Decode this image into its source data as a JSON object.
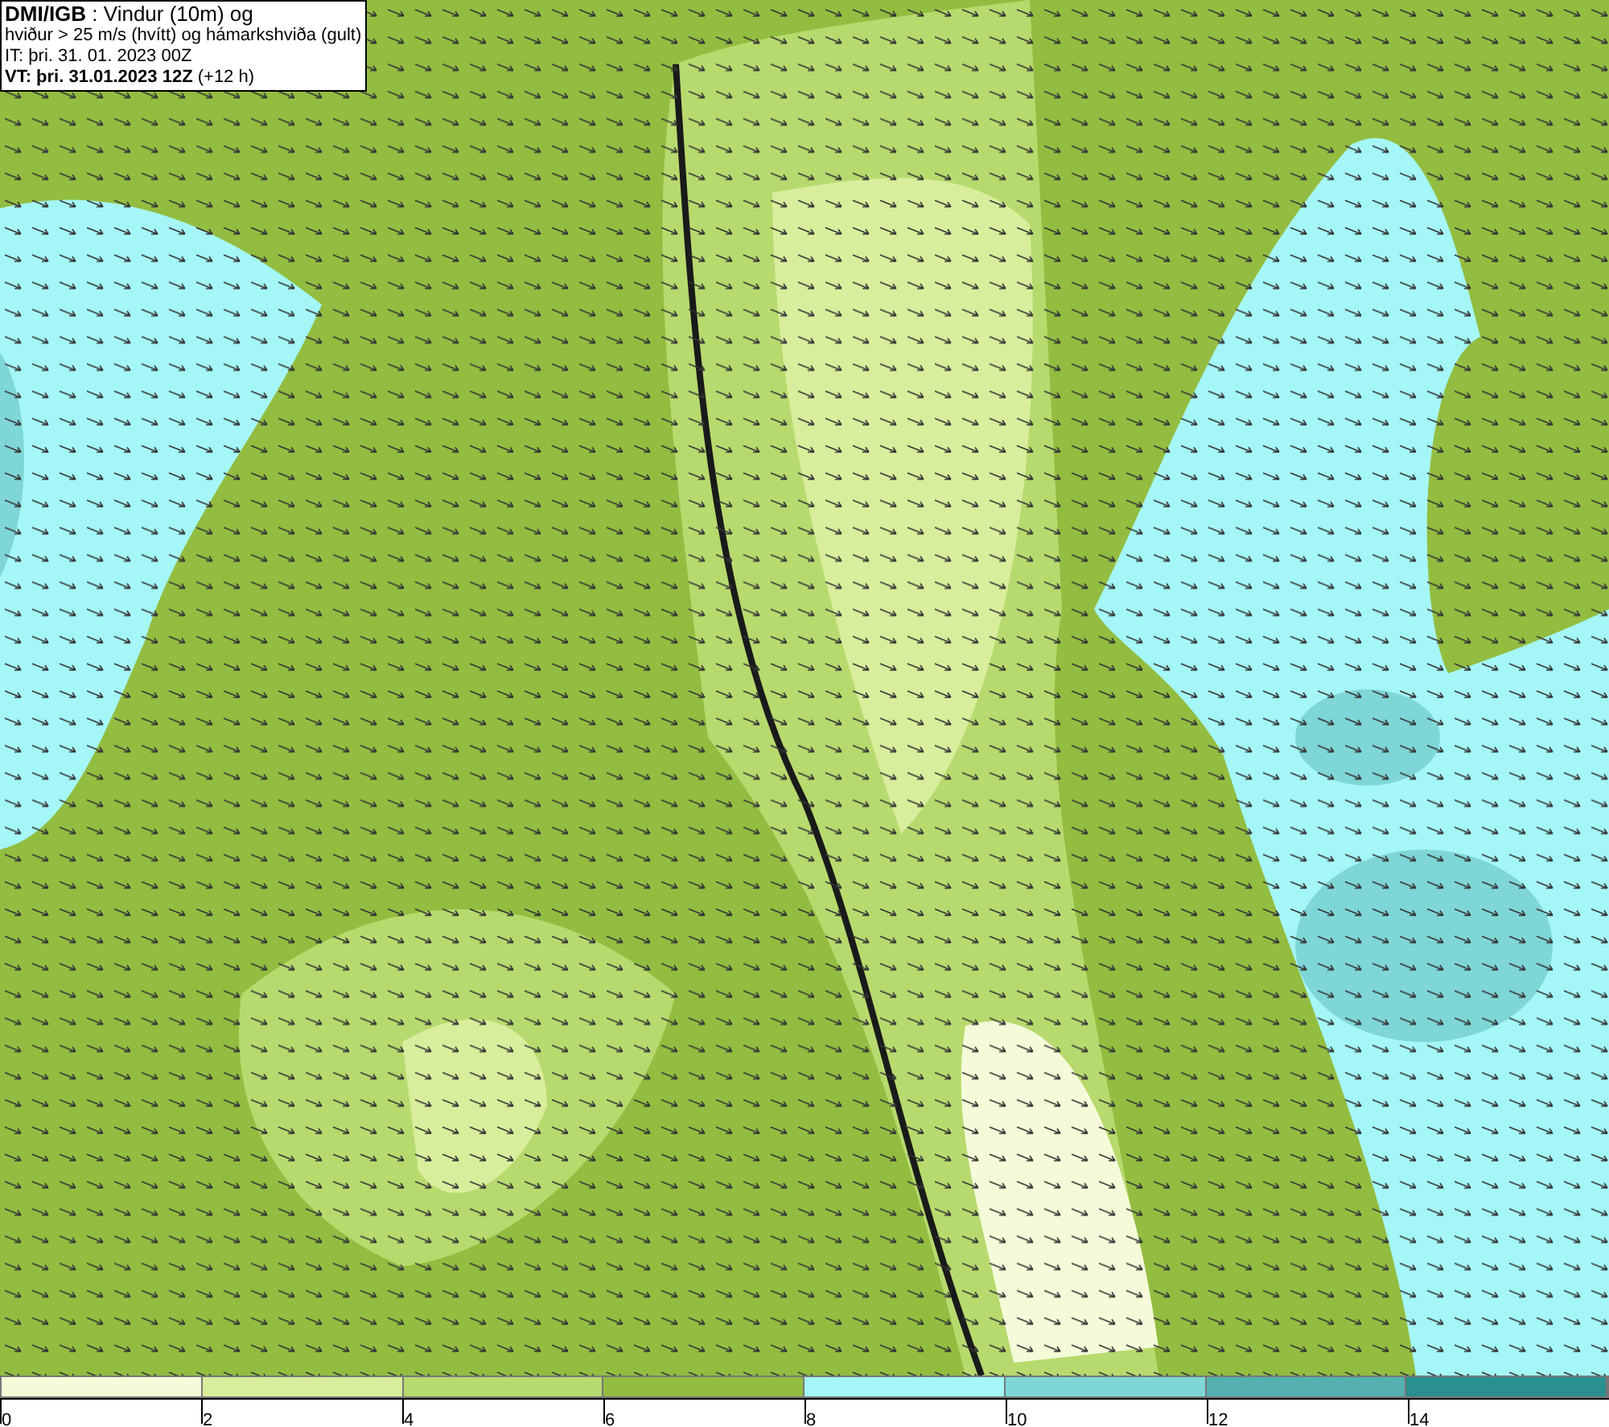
{
  "legend": {
    "lines": [
      "**DMI/IGB** : Vindur (10m) og",
      "hviður > 25 m/s (hvítt) og hámarkshviða (gult)",
      "IT: þri. 31. 01. 2023 00Z",
      "**VT: þri. 31.01.2023 12Z** (+12 h)"
    ]
  },
  "scale": {
    "segments": [
      {
        "color": "#f5fbd8"
      },
      {
        "color": "#d8ee9c"
      },
      {
        "color": "#b7da6e"
      },
      {
        "color": "#93bd41"
      },
      {
        "color": "#a5f6f6"
      },
      {
        "color": "#7fd6d6"
      },
      {
        "color": "#55b0b0"
      },
      {
        "color": "#2a8f8f"
      }
    ],
    "ticks": [
      "0",
      "2",
      "4",
      "6",
      "8",
      "10",
      "12",
      "14"
    ]
  }
}
